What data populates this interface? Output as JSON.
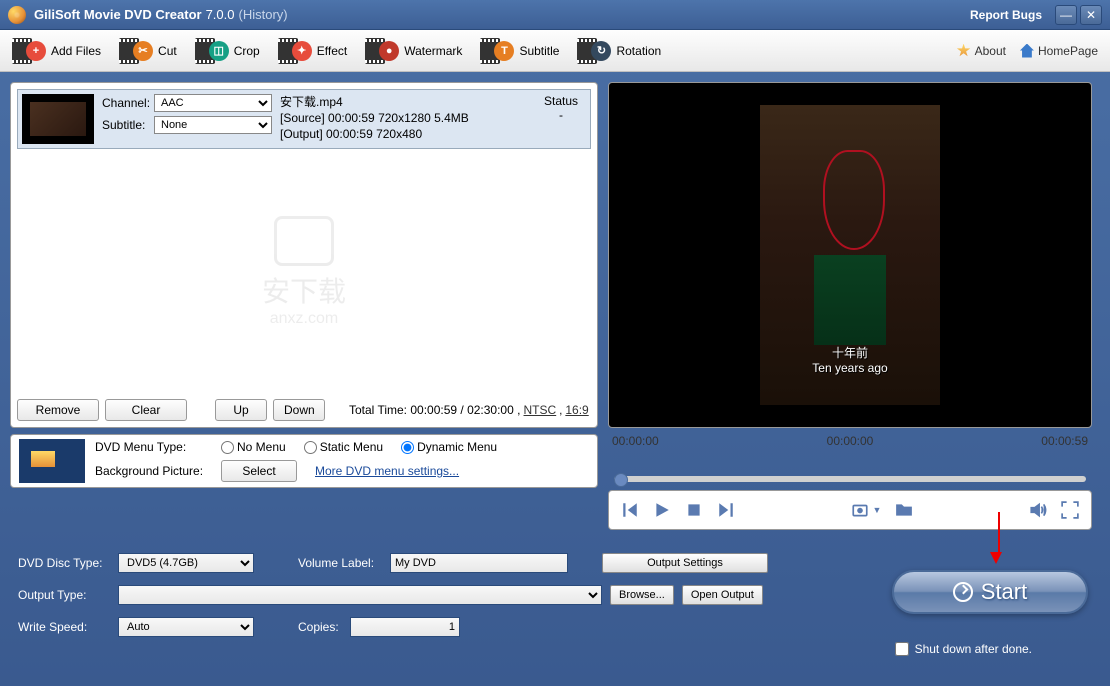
{
  "titlebar": {
    "app_name": "GiliSoft Movie DVD Creator",
    "version": "7.0.0",
    "history": "(History)",
    "report_bugs": "Report Bugs"
  },
  "toolbar": {
    "add_files": "Add Files",
    "cut": "Cut",
    "crop": "Crop",
    "effect": "Effect",
    "watermark": "Watermark",
    "subtitle": "Subtitle",
    "rotation": "Rotation",
    "about": "About",
    "homepage": "HomePage"
  },
  "file": {
    "channel_label": "Channel:",
    "channel_value": "AAC",
    "subtitle_label": "Subtitle:",
    "subtitle_value": "None",
    "filename": "安下载.mp4",
    "source_line": "[Source]  00:00:59  720x1280  5.4MB",
    "output_line": "[Output]  00:00:59  720x480",
    "status_hdr": "Status",
    "status_val": "-"
  },
  "watermark": {
    "txt1": "安下载",
    "txt2": "anxz.com"
  },
  "list_controls": {
    "remove": "Remove",
    "clear": "Clear",
    "up": "Up",
    "down": "Down",
    "total": "Total Time:  00:00:59 / 02:30:00  ,",
    "ntsc": "NTSC",
    "ratio": "16:9"
  },
  "menu": {
    "type_label": "DVD Menu Type:",
    "bg_label": "Background  Picture:",
    "no_menu": "No Menu",
    "static_menu": "Static Menu",
    "dynamic_menu": "Dynamic Menu",
    "select": "Select",
    "more": "More DVD menu settings..."
  },
  "preview": {
    "sub1": "十年前",
    "sub2": "Ten years ago",
    "t0": "00:00:00",
    "t1": "00:00:00",
    "t2": "00:00:59"
  },
  "bottom": {
    "disc_type_label": "DVD Disc Type:",
    "disc_type_value": "DVD5 (4.7GB)",
    "output_type_label": "Output Type:",
    "output_type_value": "",
    "write_speed_label": "Write Speed:",
    "write_speed_value": "Auto",
    "copies_label": "Copies:",
    "copies_value": "1",
    "volume_label": "Volume Label:",
    "volume_value": "My DVD",
    "output_settings": "Output Settings",
    "browse": "Browse...",
    "open_output": "Open Output"
  },
  "actions": {
    "start": "Start",
    "shutdown": "Shut down after done."
  }
}
